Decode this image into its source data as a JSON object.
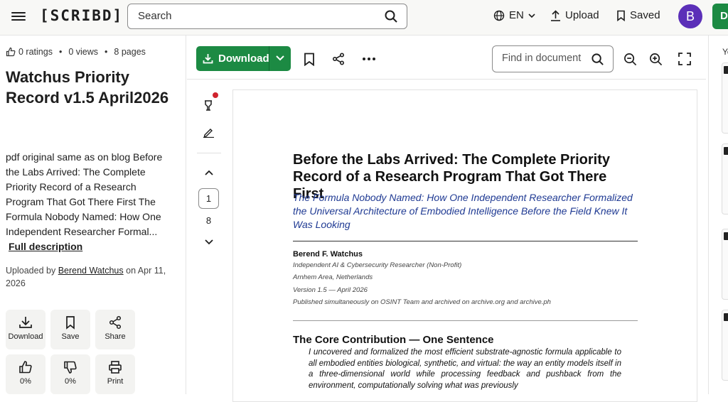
{
  "topbar": {
    "logo": "[SCRIBD]",
    "search_placeholder": "Search",
    "language": "EN",
    "upload": "Upload",
    "saved": "Saved",
    "avatar_initial": "B",
    "green_tab": "D"
  },
  "meta": {
    "ratings": "0 ratings",
    "views": "0 views",
    "pages": "8 pages"
  },
  "doc_title": "Watchus Priority Record v1.5 April2026",
  "description": "pdf original same as on blog Before the Labs Arrived: The Complete Priority Record of a Research Program That Got There First The Formula Nobody Named: How One Independent Researcher Formal...",
  "full_description": "Full description",
  "uploaded": {
    "prefix": "Uploaded by",
    "user": "Berend Watchus",
    "date": "on Apr 11, 2026"
  },
  "actions": [
    {
      "label": "Download",
      "icon": "download-icon"
    },
    {
      "label": "Save",
      "icon": "bookmark-icon"
    },
    {
      "label": "Share",
      "icon": "share-icon"
    },
    {
      "label": "0%",
      "icon": "thumbs-up-icon"
    },
    {
      "label": "0%",
      "icon": "thumbs-down-icon"
    },
    {
      "label": "Print",
      "icon": "printer-icon"
    }
  ],
  "toolbar": {
    "download": "Download",
    "find_placeholder": "Find in document"
  },
  "pager": {
    "current": "1",
    "total": "8"
  },
  "page": {
    "title": "Before the Labs Arrived: The Complete Priority Record of a Research Program That Got There First",
    "subtitle": "The Formula Nobody Named: How One Independent Researcher Formalized the Universal Architecture of Embodied Intelligence Before the Field Knew It Was Looking",
    "author": "Berend F. Watchus",
    "affiliation": "Independent AI & Cybersecurity Researcher (Non-Profit)",
    "location": "Arnhem Area, Netherlands",
    "version": "Version 1.5 — April 2026",
    "published": "Published simultaneously on OSINT Team and archived on archive.org and archive.ph",
    "section_heading": "The Core Contribution — One Sentence",
    "section_body": "I uncovered and formalized the most efficient substrate-agnostic formula applicable to all embodied entities biological, synthetic, and virtual: the way an entity models itself in a three-dimensional world while processing feedback and pushback from the environment, computationally solving what was previously"
  },
  "rightstrip": {
    "label": "Yo"
  },
  "colors": {
    "brand_green": "#1c8a43",
    "avatar_purple": "#5b2fb8",
    "subtitle_blue": "#1f3a93",
    "notification_red": "#d0232e"
  }
}
